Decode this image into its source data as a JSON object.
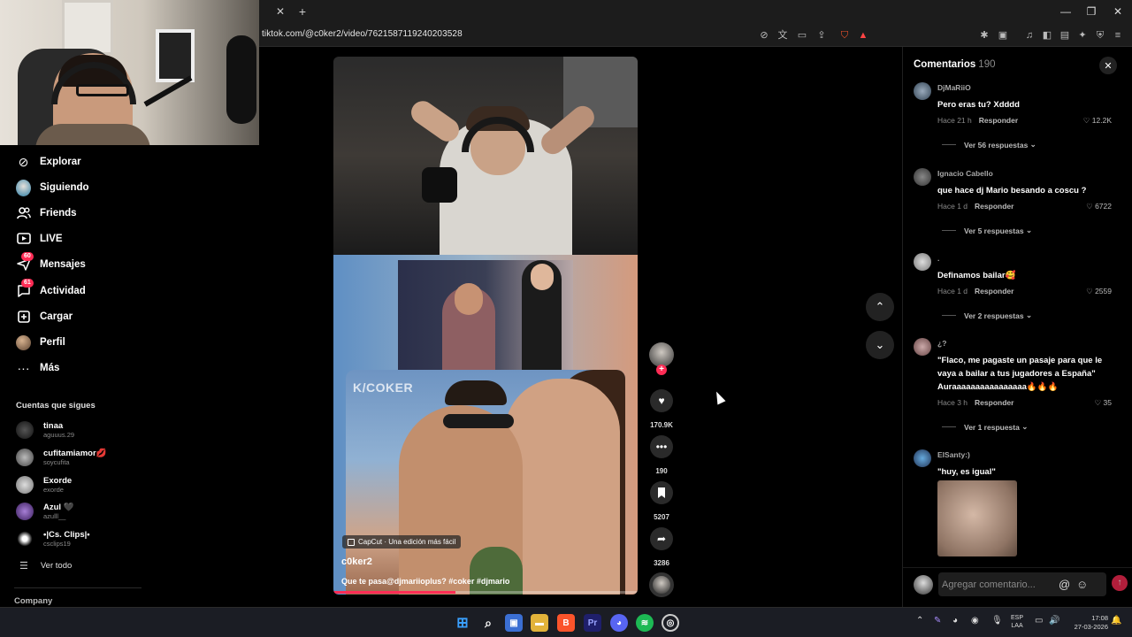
{
  "browser": {
    "url": "tiktok.com/@c0ker2/video/7621587119240203528",
    "tab_close": "✕",
    "tab_new": "+",
    "window_controls": [
      "—",
      "❐",
      "✕"
    ]
  },
  "sidebar": {
    "nav": [
      {
        "label": "Explorar",
        "icon": "compass-icon"
      },
      {
        "label": "Siguiendo",
        "icon": "following-avatar-icon"
      },
      {
        "label": "Friends",
        "icon": "friends-icon"
      },
      {
        "label": "LIVE",
        "icon": "live-icon"
      },
      {
        "label": "Mensajes",
        "icon": "messages-icon",
        "badge": "60"
      },
      {
        "label": "Actividad",
        "icon": "activity-icon",
        "badge": "61"
      },
      {
        "label": "Cargar",
        "icon": "upload-icon"
      },
      {
        "label": "Perfil",
        "icon": "profile-avatar-icon"
      },
      {
        "label": "Más",
        "icon": "more-icon"
      }
    ],
    "following_title": "Cuentas que sigues",
    "following": [
      {
        "name": "tinaa",
        "handle": "aguuus.29"
      },
      {
        "name": "cufitamiamor💋",
        "handle": "soycufita"
      },
      {
        "name": "Exorde",
        "handle": "exorde"
      },
      {
        "name": "Azul 🖤",
        "handle": "azulll__"
      },
      {
        "name": "•|Cs. Clips|•",
        "handle": "csclips19"
      }
    ],
    "see_all": "Ver todo",
    "company": "Company"
  },
  "video": {
    "overlay_logo": "K/COKER",
    "capcut": "CapCut · Una edición más fácil",
    "author": "c0ker2",
    "caption": "Que te pasa@djmariioplus? #coker #djmario",
    "progress": 0.4
  },
  "actions": {
    "likes": "170.9K",
    "comments": "190",
    "saves": "5207",
    "shares": "3286"
  },
  "comments_panel": {
    "title": "Comentarios",
    "count": "190",
    "items": [
      {
        "user": "DjMaRiiO",
        "text": "Pero eras tu? Xdddd",
        "time": "Hace 21 h",
        "reply": "Responder",
        "likes": "12.2K",
        "more": "Ver 56 respuestas"
      },
      {
        "user": "Ignacio Cabello",
        "text": "que hace dj Mario besando a coscu ?",
        "time": "Hace 1 d",
        "reply": "Responder",
        "likes": "6722",
        "more": "Ver 5 respuestas"
      },
      {
        "user": ".",
        "text": "Definamos bailar🥰",
        "time": "Hace 1 d",
        "reply": "Responder",
        "likes": "2559",
        "more": "Ver 2 respuestas"
      },
      {
        "user": "¿?",
        "text": "\"Flaco, me pagaste un pasaje para que le vaya a bailar a tus jugadores a España\" Auraaaaaaaaaaaaaaaa🔥🔥🔥",
        "time": "Hace 3 h",
        "reply": "Responder",
        "likes": "35",
        "more": "Ver 1 respuesta"
      },
      {
        "user": "ElSanty:)",
        "text": "\"huy, es igual\""
      }
    ],
    "input_placeholder": "Agregar comentario...",
    "at": "@",
    "emoji": "☺"
  },
  "taskbar": {
    "lang": [
      "ESP",
      "LAA"
    ],
    "time": "17:08",
    "date": "27-03-2026"
  },
  "colors": {
    "accent": "#fe2c55",
    "background": "#000000",
    "panel": "#1c1c1c"
  }
}
